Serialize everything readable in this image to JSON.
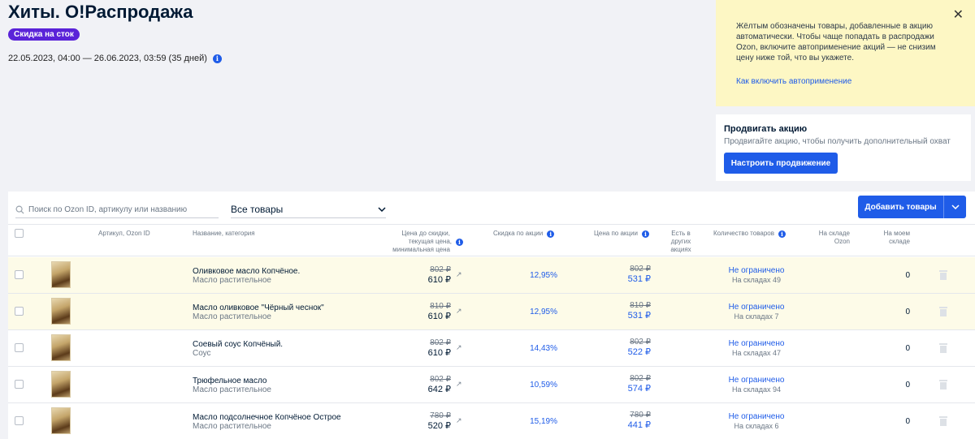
{
  "page": {
    "title": "Хиты. О!Распродажа",
    "badge": "Скидка на сток",
    "dates": "22.05.2023, 04:00 — 26.06.2023, 03:59 (35 дней)"
  },
  "notice": {
    "text": "Жёлтым обозначены товары, добавленные в акцию автоматически. Чтобы чаще попадать в распродажи Ozon, включите автоприменение акций — не снизим цену ниже той, что вы укажете.",
    "link": "Как включить автоприменение",
    "close": "✕"
  },
  "promo": {
    "title": "Продвигать акцию",
    "subtitle": "Продвигайте акцию, чтобы получить дополнительный охват",
    "button": "Настроить продвижение"
  },
  "toolbar": {
    "search_placeholder": "Поиск по Ozon ID, артикулу или названию",
    "filter_value": "Все товары",
    "add_button": "Добавить товары"
  },
  "table": {
    "headers": {
      "article": "Артикул, Ozon ID",
      "name": "Название, категория",
      "price_before_1": "Цена до скидки,",
      "price_before_2": "текущая цена,",
      "price_before_3": "минимальная цена",
      "discount": "Скидка по акции",
      "action_price": "Цена по акции",
      "other_1": "Есть в",
      "other_2": "других",
      "other_3": "акциях",
      "quantity": "Количество товаров",
      "ozon_wh_1": "На складе",
      "ozon_wh_2": "Ozon",
      "my_wh_1": "На моем",
      "my_wh_2": "складе"
    },
    "rows": [
      {
        "name": "Оливковое масло Копчёное.",
        "category": "Масло растительное",
        "old_price": "802 ₽",
        "price": "610 ₽",
        "discount": "12,95%",
        "action_old": "802 ₽",
        "action_price": "531 ₽",
        "qty": "Не ограничено",
        "qty_sub": "На складах 49",
        "stock": "0"
      },
      {
        "name": "Масло оливковое \"Чёрный чеснок\"",
        "category": "Масло растительное",
        "old_price": "810 ₽",
        "price": "610 ₽",
        "discount": "12,95%",
        "action_old": "810 ₽",
        "action_price": "531 ₽",
        "qty": "Не ограничено",
        "qty_sub": "На складах 7",
        "stock": "0"
      },
      {
        "name": "Соевый соус Копчёный.",
        "category": "Соус",
        "old_price": "802 ₽",
        "price": "610 ₽",
        "discount": "14,43%",
        "action_old": "802 ₽",
        "action_price": "522 ₽",
        "qty": "Не ограничено",
        "qty_sub": "На складах 47",
        "stock": "0"
      },
      {
        "name": "Трюфельное масло",
        "category": "Масло растительное",
        "old_price": "802 ₽",
        "price": "642 ₽",
        "discount": "10,59%",
        "action_old": "802 ₽",
        "action_price": "574 ₽",
        "qty": "Не ограничено",
        "qty_sub": "На складах 94",
        "stock": "0"
      },
      {
        "name": "Масло подсолнечное Копчёное Острое",
        "category": "Масло растительное",
        "old_price": "780 ₽",
        "price": "520 ₽",
        "discount": "15,19%",
        "action_old": "780 ₽",
        "action_price": "441 ₽",
        "qty": "Не ограничено",
        "qty_sub": "На складах 6",
        "stock": "0"
      }
    ]
  },
  "colors": {
    "accent": "#1f5ce8",
    "badge": "#5a23d8",
    "notice_bg": "#fdf7c4",
    "auto_row_bg": "#fdfbe8"
  }
}
